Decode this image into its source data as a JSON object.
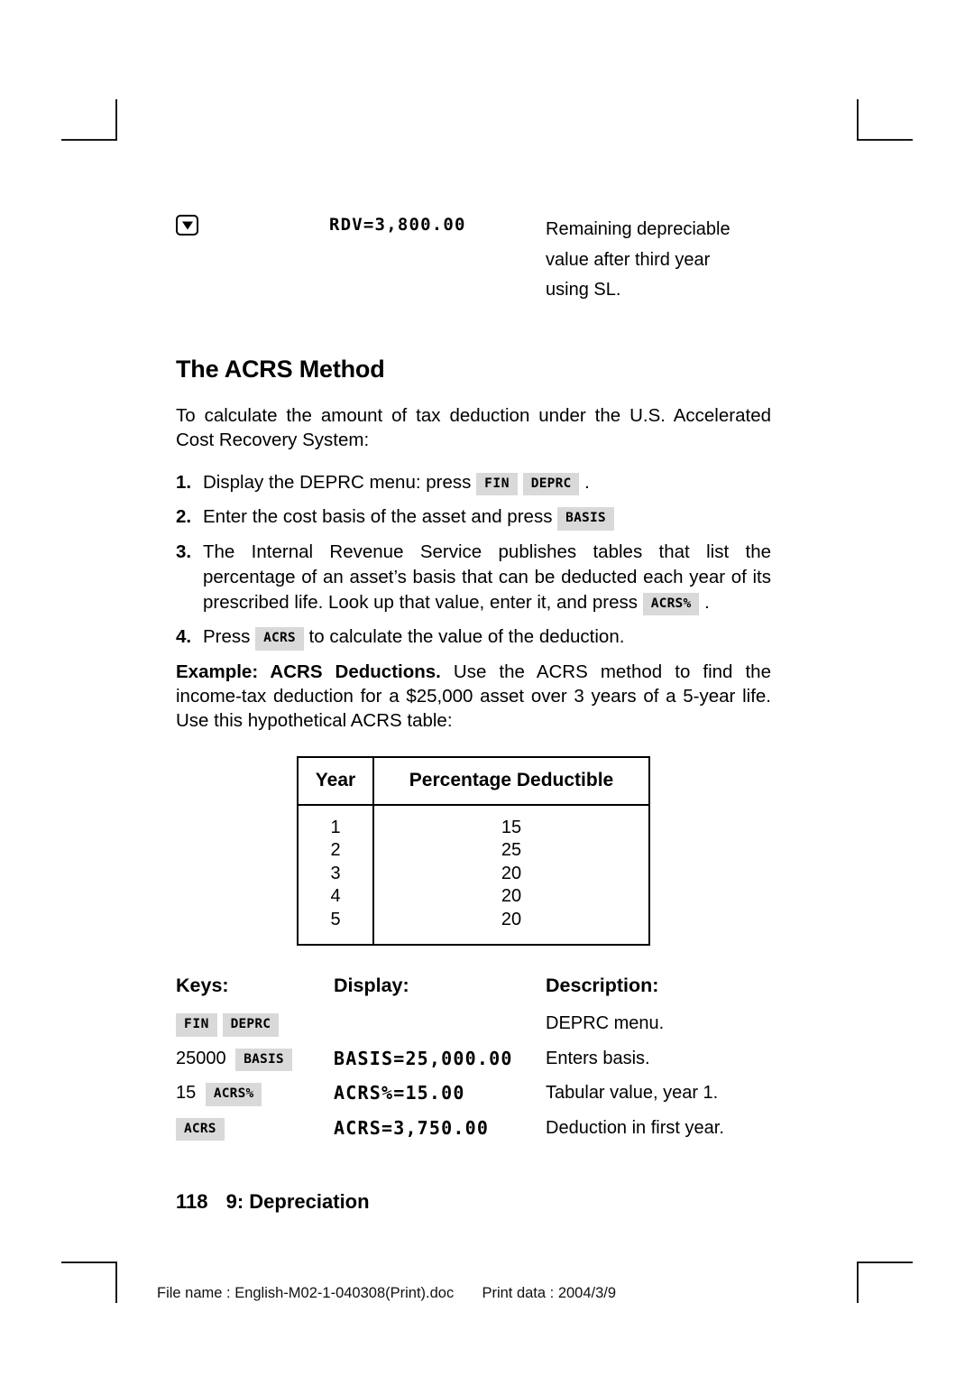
{
  "top_display": {
    "key_icon": "down-arrow-key",
    "display_value": "RDV=3,800.00",
    "description_lines": [
      "Remaining depreciable",
      "value after third year",
      "using SL."
    ]
  },
  "section": {
    "title": "The ACRS Method",
    "intro": "To calculate the amount of tax deduction under the U.S. Accelerated Cost Recovery System:"
  },
  "steps": [
    {
      "num": "1.",
      "before": "Display the DEPRC menu: press",
      "keys": [
        "FIN",
        "DEPRC"
      ],
      "after": "."
    },
    {
      "num": "2.",
      "before": "Enter the cost basis of the asset and press",
      "keys": [
        "BASIS"
      ],
      "after": ""
    },
    {
      "num": "3.",
      "before": "The Internal Revenue Service publishes tables that list the percentage of an asset’s basis that can be deducted each year of its prescribed life. Look up that value, enter it, and press",
      "keys": [
        "ACRS%"
      ],
      "after": "."
    },
    {
      "num": "4.",
      "before": "Press",
      "keys": [
        "ACRS"
      ],
      "after": "to calculate the value of the deduction."
    }
  ],
  "example": {
    "label": "Example: ACRS Deductions.",
    "text": "Use the ACRS method to find the income-tax deduction for a $25,000 asset over 3 years of a 5-year life. Use this hypothetical ACRS table:"
  },
  "acrs_table": {
    "headers": [
      "Year",
      "Percentage Deductible"
    ],
    "rows": [
      [
        "1",
        "15"
      ],
      [
        "2",
        "25"
      ],
      [
        "3",
        "20"
      ],
      [
        "4",
        "20"
      ],
      [
        "5",
        "20"
      ]
    ]
  },
  "keystroke_example": {
    "headers": [
      "Keys:",
      "Display:",
      "Description:"
    ],
    "rows": [
      {
        "num_prefix": "",
        "keys": [
          "FIN",
          "DEPRC"
        ],
        "display": "",
        "description": "DEPRC menu."
      },
      {
        "num_prefix": "25000",
        "keys": [
          "BASIS"
        ],
        "display": "BASIS=25,000.00",
        "description": "Enters basis."
      },
      {
        "num_prefix": "15",
        "keys": [
          "ACRS%"
        ],
        "display": "ACRS%=15.00",
        "description": "Tabular value, year 1."
      },
      {
        "num_prefix": "",
        "keys": [
          "ACRS"
        ],
        "display": "ACRS=3,750.00",
        "description": "Deduction in first year."
      }
    ]
  },
  "page_footer": {
    "page_number": "118",
    "chapter": "9: Depreciation"
  },
  "print_info": {
    "file_name_label": "File name : English-M02-1-040308(Print).doc",
    "print_date_label": "Print data : 2004/3/9"
  },
  "colors": {
    "key_background": "#d9d9d9",
    "text": "#000000",
    "crop_mark": "#1a1a1a"
  }
}
